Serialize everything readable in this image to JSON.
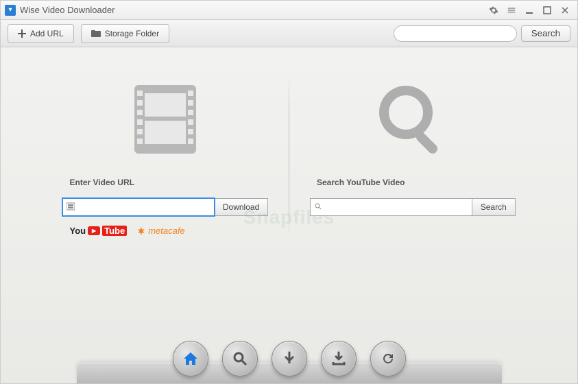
{
  "titlebar": {
    "app_title": "Wise Video Downloader"
  },
  "toolbar": {
    "add_url_label": "Add URL",
    "storage_folder_label": "Storage Folder",
    "search_button_label": "Search"
  },
  "left_panel": {
    "heading": "Enter Video URL",
    "download_button_label": "Download",
    "url_value": ""
  },
  "right_panel": {
    "heading": "Search YouTube Video",
    "search_button_label": "Search",
    "search_value": ""
  },
  "sources": {
    "youtube_text_a": "You",
    "youtube_text_b": "Tube",
    "metacafe_text": "metacafe"
  },
  "watermark": "Snapfiles",
  "icons": {
    "settings": "gear-icon",
    "menu": "menu-icon",
    "minimize": "minimize-icon",
    "maximize": "maximize-icon",
    "close": "close-icon",
    "plus": "plus-icon",
    "folder": "folder-icon",
    "search": "search-icon",
    "film": "film-icon",
    "home": "home-icon",
    "download": "download-arrow-icon",
    "download_tray": "download-tray-icon",
    "refresh": "refresh-icon"
  }
}
